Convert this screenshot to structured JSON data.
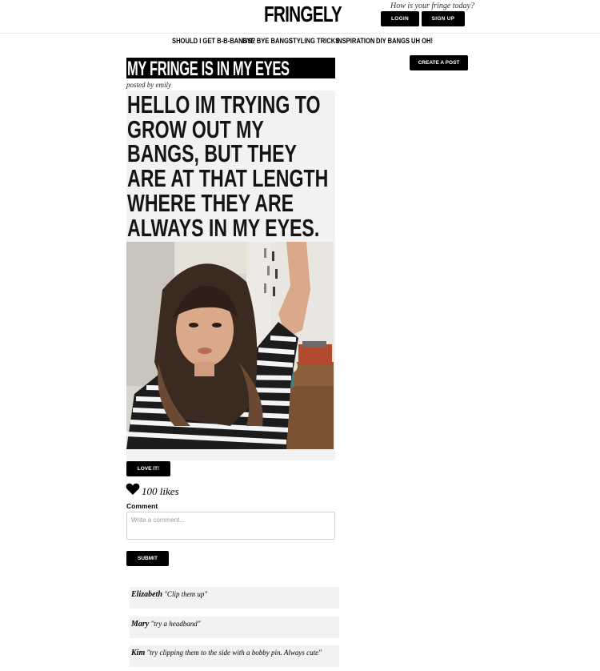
{
  "header": {
    "logo": "FRINGELY",
    "tagline": "How is your fringe today?",
    "login_label": "LOGIN",
    "signup_label": "SIGN UP"
  },
  "nav": {
    "items": [
      {
        "label": "SHOULD I GET B-B-BANGS?"
      },
      {
        "label": "BYE BYE BANGS"
      },
      {
        "label": "STYLING TRICKS"
      },
      {
        "label": "INSPIRATION"
      },
      {
        "label": "DIY BANGS"
      },
      {
        "label": "UH OH!"
      }
    ]
  },
  "create_post_label": "CREATE A POST",
  "post": {
    "title": "MY FRINGE IS IN MY EYES",
    "posted_by": "posted by emily",
    "body": "HELLO IM TRYING TO GROW OUT MY BANGS, BUT THEY ARE AT THAT LENGTH WHERE THEY ARE ALWAYS IN MY EYES. HELP! ANY IDEAS?",
    "photo_icon": "selfie-photo",
    "love_label": "LOVE IT!",
    "likes": "100 likes"
  },
  "comment_form": {
    "label": "Comment",
    "placeholder": "Write a comment...",
    "submit_label": "SUBMIT"
  },
  "comments": [
    {
      "author": "Elizabeth",
      "text": "\"Clip them up\""
    },
    {
      "author": "Mary",
      "text": "\"try a headband\""
    },
    {
      "author": "Kim",
      "text": "\"try clipping them to the side with a bobby pin. Always cute\""
    }
  ],
  "colors": {
    "accent": "#000000",
    "card_bg": "#f2f2f2"
  }
}
